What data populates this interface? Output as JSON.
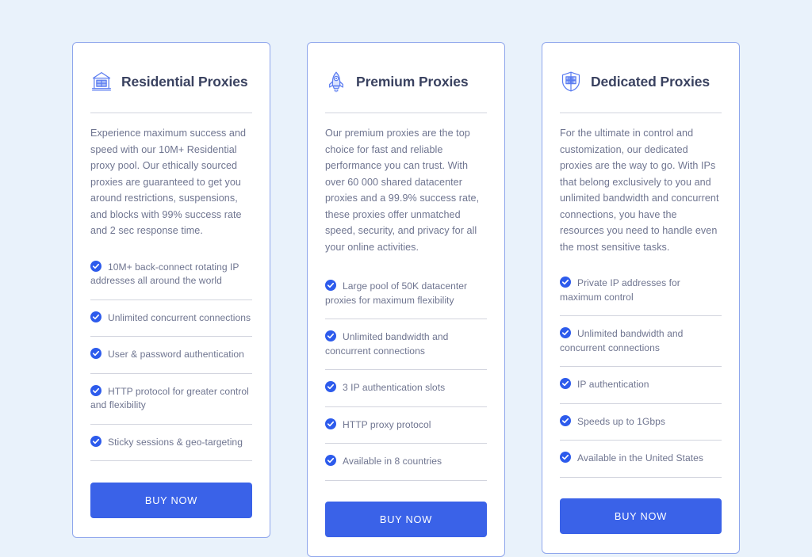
{
  "theme": {
    "page_background": "#e9f2fb",
    "card_background": "#ffffff",
    "card_border": "#8fa6ec",
    "accent": "#3a62e8",
    "title_color": "#3a4260",
    "text_color": "#6f7590",
    "divider_color": "#d2d4de"
  },
  "cards": [
    {
      "icon": "bank-building-icon",
      "title": "Residential Proxies",
      "description": "Experience maximum success and speed with our 10M+ Residential proxy pool. Our ethically sourced proxies are guaranteed to get you around restrictions, suspensions, and blocks with 99% success rate and 2 sec response time.",
      "features": [
        "10M+ back-connect rotating IP addresses all around the world",
        "Unlimited concurrent connections",
        "User & password authentication",
        "HTTP protocol for greater control and flexibility",
        "Sticky sessions & geo-targeting"
      ],
      "cta_label": "BUY NOW"
    },
    {
      "icon": "rocket-icon",
      "title": "Premium Proxies",
      "description": "Our premium proxies are the top choice for fast and reliable performance you can trust. With over 60 000 shared datacenter proxies and a 99.9% success rate, these proxies offer unmatched speed, security, and privacy for all your online activities.",
      "features": [
        "Large pool of 50K datacenter proxies for maximum flexibility",
        "Unlimited bandwidth and concurrent connections",
        "3 IP authentication slots",
        "HTTP proxy protocol",
        "Available in 8 countries"
      ],
      "cta_label": "BUY NOW"
    },
    {
      "icon": "shield-server-icon",
      "title": "Dedicated Proxies",
      "description": "For the ultimate in control and customization, our dedicated proxies are the way to go. With IPs that belong exclusively to you and unlimited bandwidth and concurrent connections, you have the resources you need to handle even the most sensitive tasks.",
      "features": [
        "Private IP addresses for maximum control",
        "Unlimited bandwidth and concurrent connections",
        "IP authentication",
        "Speeds up to 1Gbps",
        "Available in the United States"
      ],
      "cta_label": "BUY NOW"
    }
  ]
}
